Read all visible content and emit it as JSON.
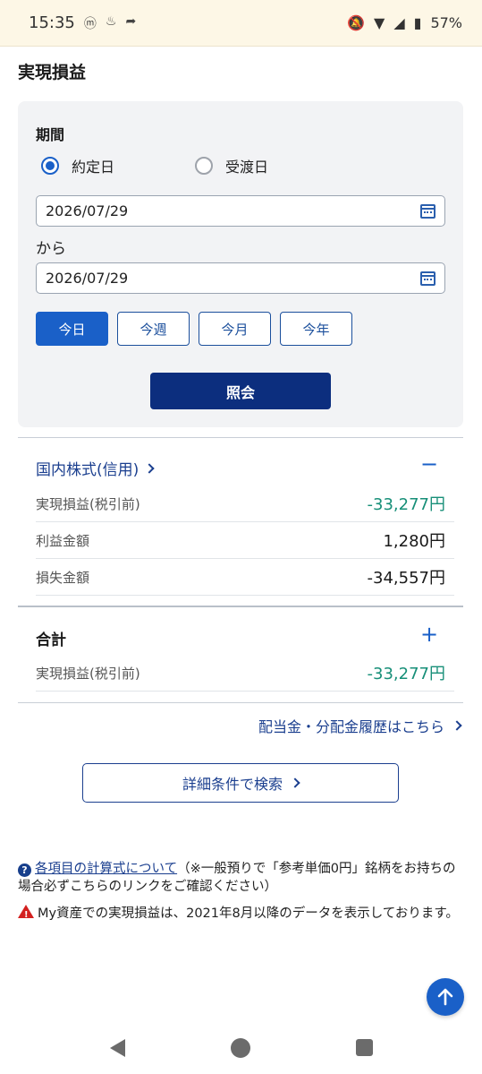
{
  "status_bar": {
    "time": "15:35",
    "battery": "57%",
    "icons": [
      "mute-icon",
      "wifi-icon",
      "signal-icon",
      "battery-icon"
    ]
  },
  "page": {
    "title": "実現損益"
  },
  "period": {
    "label": "期間",
    "radio_options": [
      {
        "label": "約定日",
        "selected": true
      },
      {
        "label": "受渡日",
        "selected": false
      }
    ],
    "from_date": "2026/07/29",
    "separator": "から",
    "to_date": "2026/07/29",
    "quick_buttons": [
      {
        "label": "今日",
        "active": true
      },
      {
        "label": "今週",
        "active": false
      },
      {
        "label": "今月",
        "active": false
      },
      {
        "label": "今年",
        "active": false
      }
    ],
    "submit_label": "照会"
  },
  "domestic_margin": {
    "title": "国内株式(信用)",
    "toggle": "−",
    "rows": [
      {
        "label": "実現損益(税引前)",
        "value": "-33,277円"
      },
      {
        "label": "利益金額",
        "value": "1,280円"
      },
      {
        "label": "損失金額",
        "value": "-34,557円"
      }
    ]
  },
  "total": {
    "title": "合計",
    "toggle": "+",
    "rows": [
      {
        "label": "実現損益(税引前)",
        "value": "-33,277円"
      }
    ]
  },
  "links": {
    "dividend_history": "配当金・分配金履歴はこちら",
    "detail_search": "詳細条件で検索"
  },
  "notes": {
    "formula_link": "各項目の計算式について",
    "formula_text": "（※一般預りで「参考単価0円」銘柄をお持ちの場合必ずこちらのリンクをご確認ください）",
    "warning_text": "My資産での実現損益は、2021年8月以降のデータを表示しております。"
  },
  "colors": {
    "primary": "#1a60c8",
    "navy": "#0c2e7e",
    "link": "#1b3f8f",
    "loss_value": "#178f78",
    "warning": "#d3201f"
  }
}
